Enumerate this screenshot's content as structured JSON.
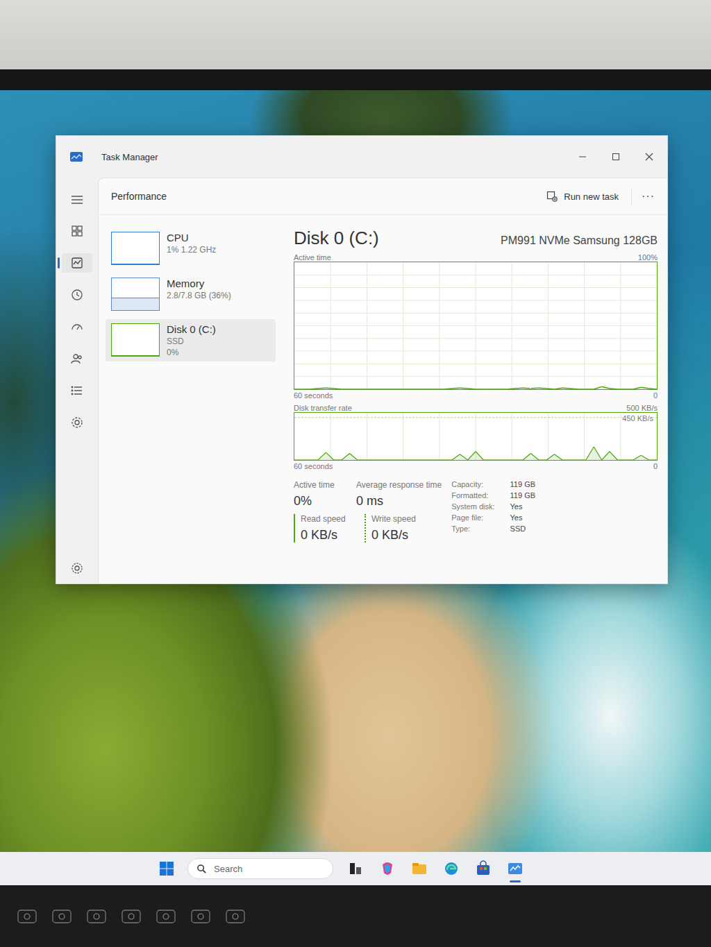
{
  "window": {
    "title": "Task Manager"
  },
  "nav": {
    "items": [
      {
        "selected": false
      },
      {
        "selected": true
      },
      {
        "selected": false
      },
      {
        "selected": false
      },
      {
        "selected": false
      },
      {
        "selected": false
      },
      {
        "selected": false
      }
    ]
  },
  "header": {
    "title": "Performance",
    "run_task": "Run new task",
    "more": "···"
  },
  "resources": [
    {
      "name": "CPU",
      "lines": [
        "1% 1.22 GHz"
      ],
      "level": 0.01,
      "color": "#2f7fd6",
      "selected": false
    },
    {
      "name": "Memory",
      "lines": [
        "2.8/7.8 GB (36%)"
      ],
      "level": 0.36,
      "color": "#5b86d6",
      "selected": false
    },
    {
      "name": "Disk 0 (C:)",
      "lines": [
        "SSD",
        "0%"
      ],
      "level": 0,
      "color": "#4da60c",
      "selected": true
    }
  ],
  "detail": {
    "title": "Disk 0 (C:)",
    "model": "PM991 NVMe Samsung 128GB",
    "active_chart": {
      "label": "Active time",
      "max": "100%",
      "span": "60 seconds",
      "min": "0",
      "values": [
        0,
        0,
        0,
        0.5,
        1,
        0.5,
        0,
        0,
        0,
        0,
        0,
        0,
        0,
        0,
        0,
        0,
        0,
        0,
        0,
        0,
        0.5,
        1,
        0.5,
        0,
        0,
        0,
        0,
        0,
        0.5,
        1,
        0.5,
        1,
        0.5,
        0,
        1,
        0.5,
        0,
        0,
        0,
        2,
        0.5,
        0,
        0,
        0,
        1.5,
        0.5,
        0
      ]
    },
    "transfer_chart": {
      "label": "Disk transfer rate",
      "max": "500 KB/s",
      "mark": "450 KB/s",
      "span": "60 seconds",
      "min": "0",
      "values": [
        0,
        0,
        0,
        0,
        80,
        0,
        0,
        70,
        0,
        0,
        0,
        0,
        0,
        0,
        0,
        0,
        0,
        0,
        0,
        0,
        0,
        60,
        0,
        90,
        0,
        0,
        0,
        0,
        0,
        0,
        70,
        0,
        0,
        60,
        0,
        0,
        0,
        0,
        140,
        0,
        90,
        0,
        0,
        0,
        50,
        0,
        0
      ]
    },
    "stats": [
      {
        "label": "Active time",
        "value": "0%"
      },
      {
        "label": "Average response time",
        "value": "0 ms"
      }
    ],
    "speeds": [
      {
        "label": "Read speed",
        "value": "0 KB/s"
      },
      {
        "label": "Write speed",
        "value": "0 KB/s"
      }
    ],
    "properties": [
      {
        "label": "Capacity:",
        "value": "119 GB"
      },
      {
        "label": "Formatted:",
        "value": "119 GB"
      },
      {
        "label": "System disk:",
        "value": "Yes"
      },
      {
        "label": "Page file:",
        "value": "Yes"
      },
      {
        "label": "Type:",
        "value": "SSD"
      }
    ]
  },
  "taskbar": {
    "search": "Search",
    "apps": [
      {
        "selected": false
      },
      {
        "selected": false
      },
      {
        "selected": false
      },
      {
        "selected": false
      },
      {
        "selected": false
      },
      {
        "selected": true
      }
    ]
  }
}
